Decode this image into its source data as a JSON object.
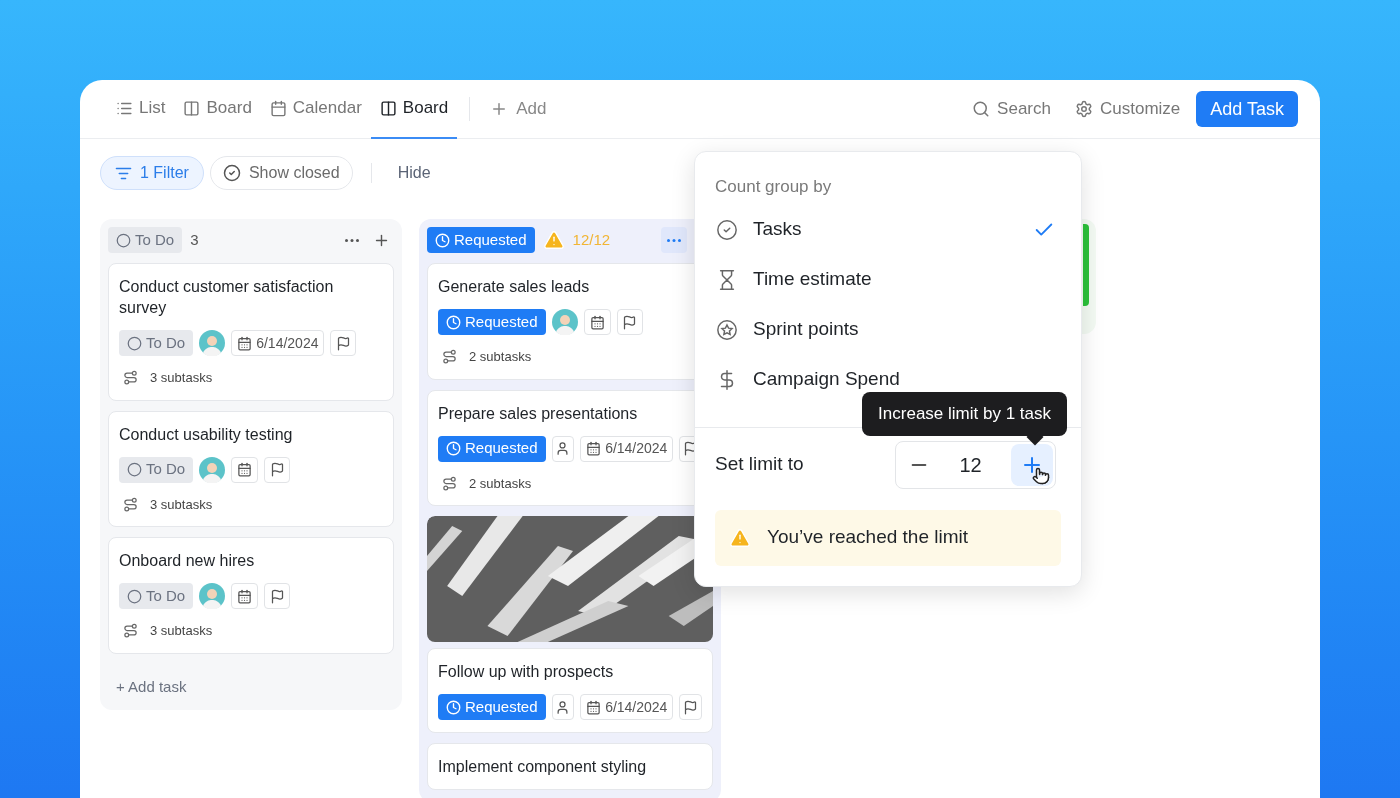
{
  "views": [
    {
      "label": "List",
      "kind": "list",
      "selected": false
    },
    {
      "label": "Board",
      "kind": "board",
      "selected": false
    },
    {
      "label": "Calendar",
      "kind": "calendar",
      "selected": false
    },
    {
      "label": "Board",
      "kind": "board",
      "selected": true
    }
  ],
  "add_view": "Add",
  "search": "Search",
  "customize": "Customize",
  "add_task": "Add Task",
  "toolbar": {
    "filter": {
      "label": "1 Filter",
      "active": true
    },
    "show_closed": "Show closed",
    "hide": "Hide"
  },
  "columns": [
    {
      "status": "To Do",
      "kind": "todo",
      "count": "3",
      "warning": false,
      "menu_active": false,
      "add_task": "+ Add task",
      "cards": [
        {
          "title": "Conduct customer satisfaction survey",
          "status": "To Do",
          "assigned": true,
          "date": "6/14/2024",
          "subtasks": "3 subtasks"
        },
        {
          "title": "Conduct usability testing",
          "status": "To Do",
          "assigned": true,
          "subtasks": "3 subtasks"
        },
        {
          "title": "Onboard new hires",
          "status": "To Do",
          "assigned": true,
          "subtasks": "3 subtasks"
        }
      ]
    },
    {
      "status": "Requested",
      "kind": "requested",
      "count": "12/12",
      "warning": true,
      "menu_active": true,
      "cards": [
        {
          "title": "Generate sales leads",
          "status": "Requested",
          "assigned": true,
          "subtasks": "2 subtasks"
        },
        {
          "title": "Prepare sales presentations",
          "status": "Requested",
          "assigned": false,
          "date": "6/14/2024",
          "subtasks": "2 subtasks"
        },
        {
          "kind": "picture"
        },
        {
          "title": "Follow up with prospects",
          "status": "Requested",
          "assigned": false,
          "date": "6/14/2024"
        },
        {
          "title": "Implement component styling"
        }
      ]
    }
  ],
  "popover": {
    "title": "Count group by",
    "options": [
      {
        "label": "Tasks",
        "kind": "tasks",
        "selected": true
      },
      {
        "label": "Time estimate",
        "kind": "time",
        "selected": false
      },
      {
        "label": "Sprint points",
        "kind": "points",
        "selected": false
      },
      {
        "label": "Campaign Spend",
        "kind": "currency",
        "selected": false
      }
    ],
    "limit_label": "Set limit to",
    "limit_value": "12",
    "tooltip": "Increase limit by 1 task",
    "warning": "You’ve reached the limit"
  }
}
